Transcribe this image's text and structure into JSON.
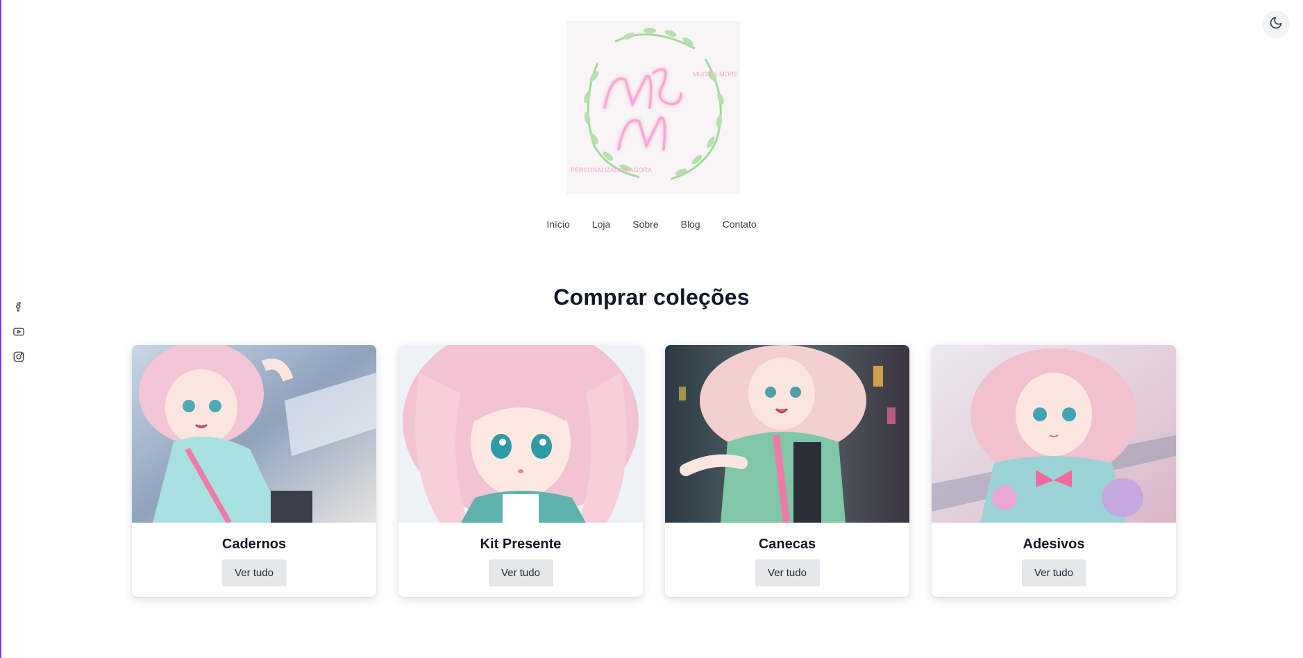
{
  "header": {
    "logo": {
      "monogram": "M&M",
      "small_text": "MUGS & MORE",
      "bottom_text": "PERSONALIZADOS AGORA"
    },
    "theme_toggle_icon": "moon-icon"
  },
  "nav": {
    "items": [
      {
        "label": "Início"
      },
      {
        "label": "Loja"
      },
      {
        "label": "Sobre"
      },
      {
        "label": "Blog"
      },
      {
        "label": "Contato"
      }
    ]
  },
  "social": {
    "icons": [
      "facebook-icon",
      "youtube-icon",
      "instagram-icon"
    ]
  },
  "collections": {
    "title": "Comprar coleções",
    "cards": [
      {
        "title": "Cadernos",
        "button": "Ver tudo"
      },
      {
        "title": "Kit Presente",
        "button": "Ver tudo"
      },
      {
        "title": "Canecas",
        "button": "Ver tudo"
      },
      {
        "title": "Adesivos",
        "button": "Ver tudo"
      }
    ]
  },
  "colors": {
    "accent_pink": "#f9a8d4",
    "wreath_green": "#a7d7a0",
    "button_bg": "#e5e7eb",
    "left_edge": "#7c3aed"
  }
}
